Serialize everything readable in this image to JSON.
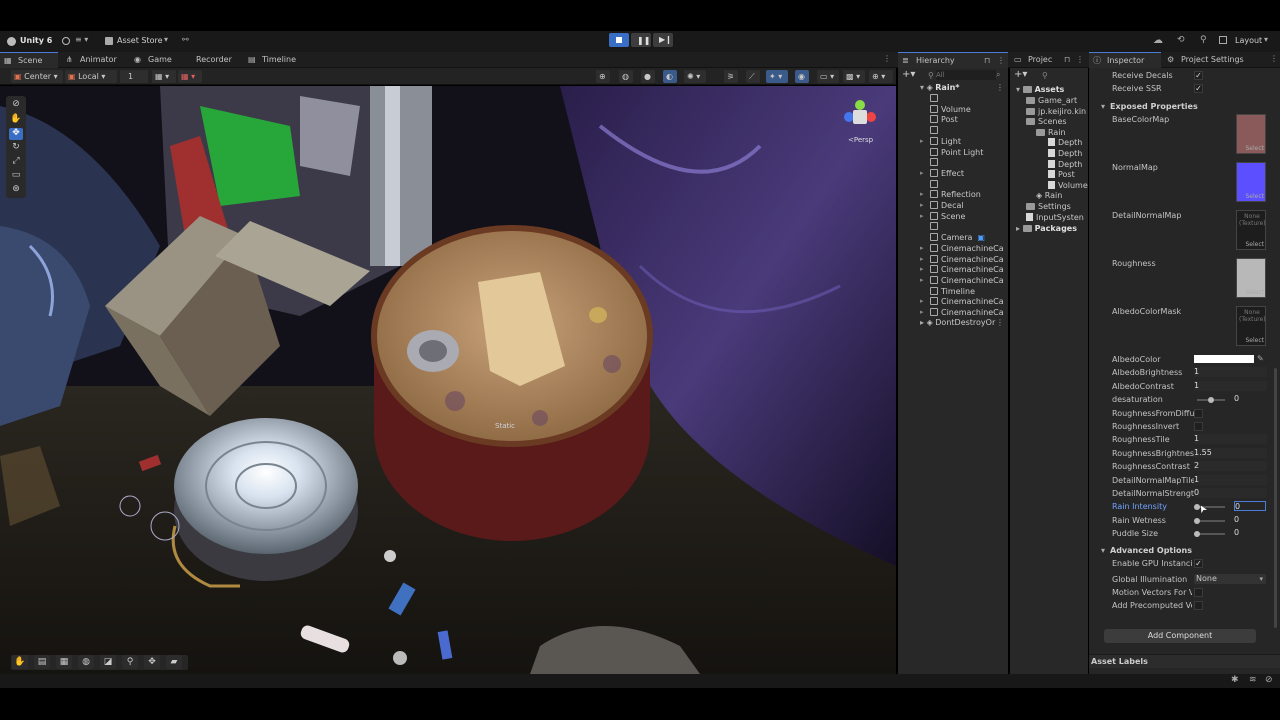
{
  "topbar": {
    "account": "Unity 6",
    "asset_store": "Asset Store",
    "layout": "Layout"
  },
  "tabs": {
    "scene": "Scene",
    "animator": "Animator",
    "game": "Game",
    "recorder": "Recorder",
    "timeline": "Timeline",
    "hierarchy": "Hierarchy",
    "project": "Projec",
    "inspector": "Inspector",
    "project_settings": "Project Settings"
  },
  "scene_toolbar": {
    "pivot": "Center",
    "space": "Local",
    "snap": "1"
  },
  "viewport": {
    "gizmo_label": "<Persp",
    "object_label": "Static"
  },
  "hierarchy": {
    "search_placeholder": "All",
    "root": "Rain*",
    "items": [
      "",
      "Volume",
      "Post",
      "",
      "Light",
      "Point Light",
      "",
      "Effect",
      "",
      "Reflection",
      "Decal",
      "Scene",
      "",
      "Camera",
      "CinemachineCa",
      "CinemachineCa",
      "CinemachineCa",
      "CinemachineCa",
      "Timeline",
      "CinemachineCa",
      "CinemachineCa"
    ],
    "dont_destroy": "DontDestroyOr"
  },
  "project": {
    "assets": "Assets",
    "tree": [
      "Game_art",
      "jp.keijiro.kin",
      "Scenes",
      "Rain",
      "Depth",
      "Depth",
      "Depth",
      "Post",
      "Volume",
      "Rain",
      "Settings",
      "InputSysten"
    ],
    "packages": "Packages"
  },
  "inspector": {
    "receive_decals": "Receive Decals",
    "receive_ssr": "Receive SSR",
    "exposed_properties": "Exposed Properties",
    "tex_base": "BaseColorMap",
    "tex_normal": "NormalMap",
    "tex_detail": "DetailNormalMap",
    "tex_rough": "Roughness",
    "tex_albedo_mask": "AlbedoColorMask",
    "none_texture": "None\n(Texture)",
    "select": "Select",
    "props": [
      {
        "label": "AlbedoColor",
        "value": ""
      },
      {
        "label": "AlbedoBrightness",
        "value": "1"
      },
      {
        "label": "AlbedoContrast",
        "value": "1"
      },
      {
        "label": "desaturation",
        "value": "0"
      },
      {
        "label": "RoughnessFromDiffu",
        "value": ""
      },
      {
        "label": "RoughnessInvert",
        "value": ""
      },
      {
        "label": "RoughnessTile",
        "value": "1"
      },
      {
        "label": "RoughnessBrightnes:",
        "value": "1.55"
      },
      {
        "label": "RoughnessContrast",
        "value": "2"
      },
      {
        "label": "DetailNormalMapTile",
        "value": "1"
      },
      {
        "label": "DetailNormalStrength",
        "value": "0"
      },
      {
        "label": "Rain Intensity",
        "value": "0"
      },
      {
        "label": "Rain Wetness",
        "value": "0"
      },
      {
        "label": "Puddle Size",
        "value": "0"
      }
    ],
    "advanced_options": "Advanced Options",
    "gpu_instancing": "Enable GPU Instancir",
    "global_illumination": "Global Illumination",
    "gi_value": "None",
    "motion_vectors": "Motion Vectors For V",
    "precomputed": "Add Precomputed Ve",
    "add_component": "Add Component",
    "asset_labels": "Asset Labels"
  },
  "colors": {
    "accent": "#4a7cd8",
    "rain_label": "#6fa3ff",
    "normal_swatch": "#5b4fff"
  }
}
